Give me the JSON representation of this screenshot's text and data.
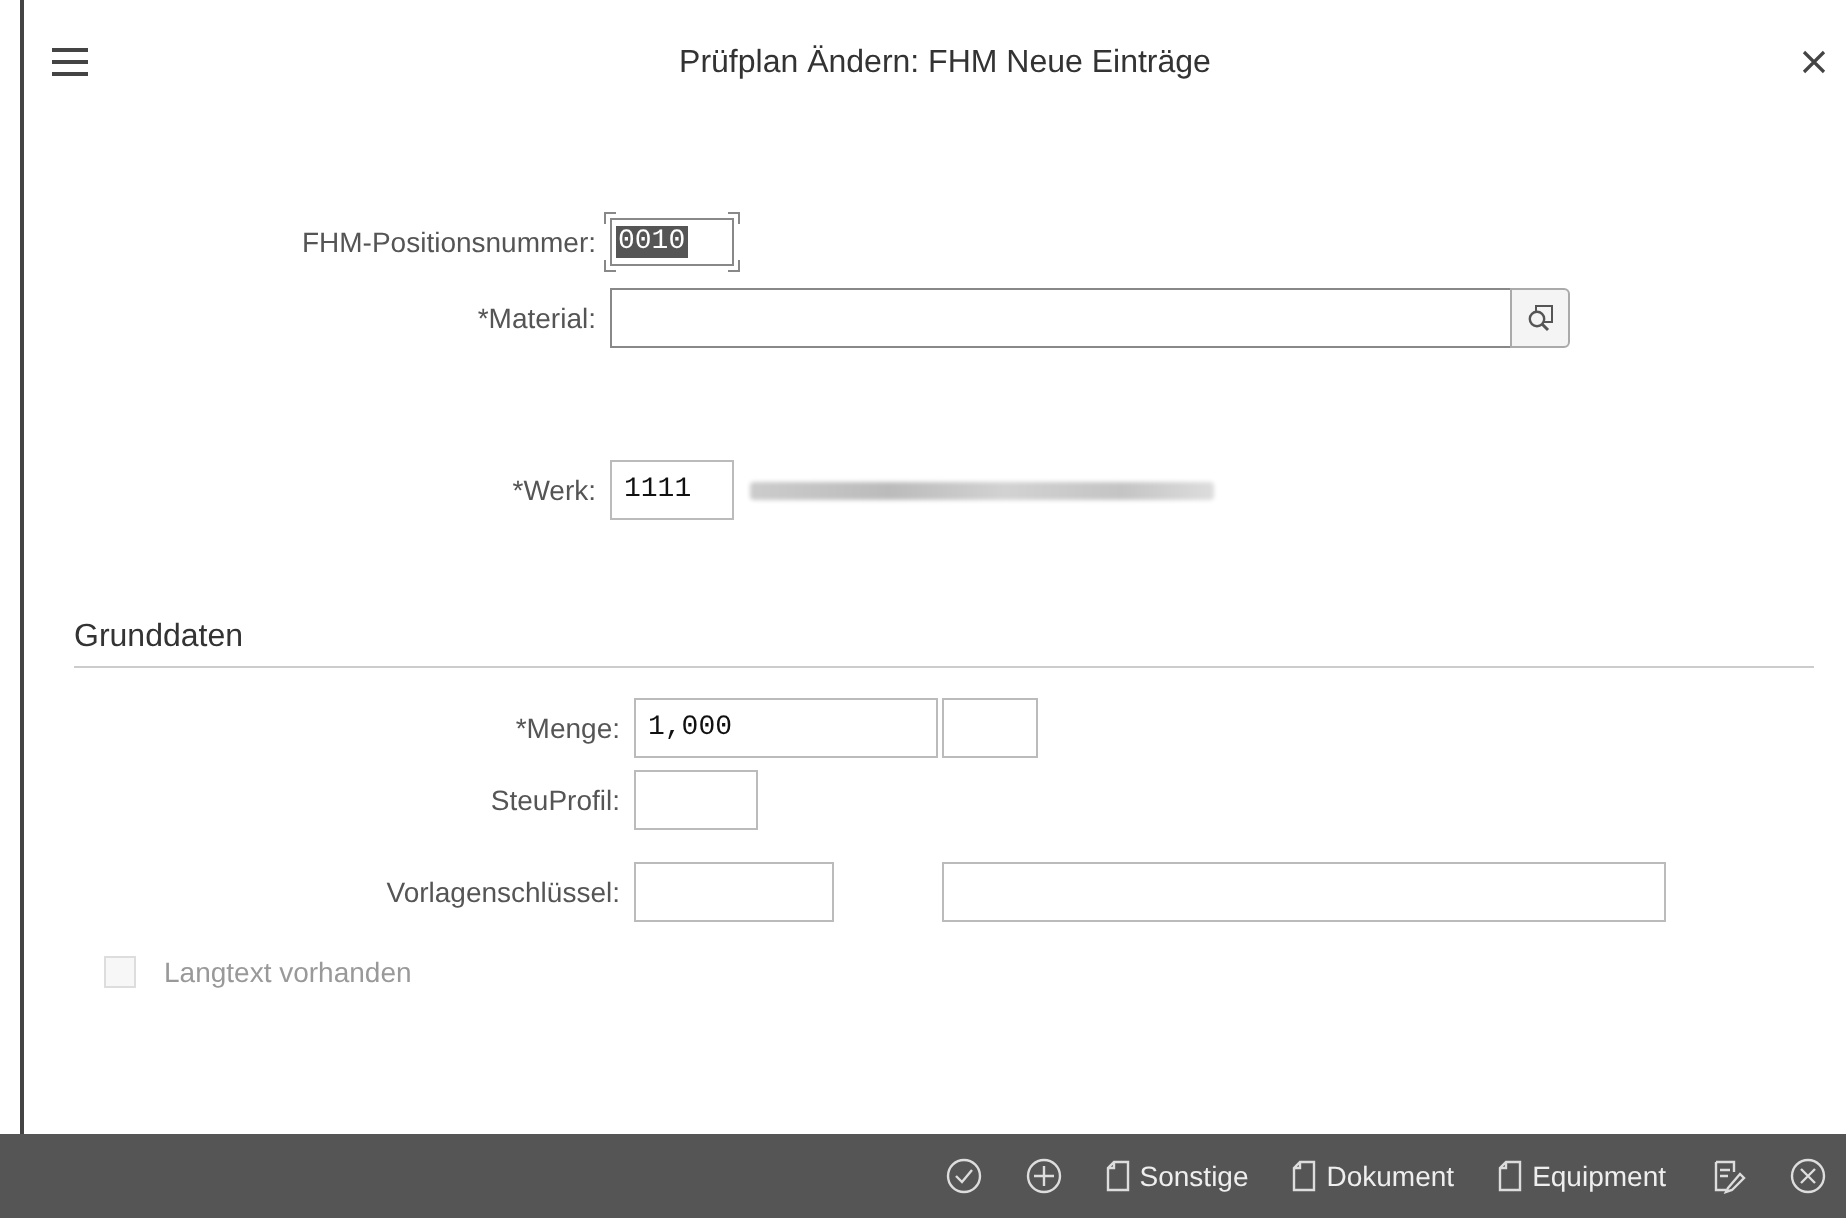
{
  "header": {
    "title": "Prüfplan Ändern: FHM Neue Einträge"
  },
  "top_fields": [
    {
      "label": "FHM-Positionsnummer:",
      "value": "0010",
      "focused": true
    },
    {
      "label": "*Material:",
      "focused": false,
      "value_help": true
    },
    {
      "label": "*Werk:",
      "value": "1111",
      "focused": false,
      "description_hidden": true
    }
  ],
  "section": {
    "title": "Grunddaten",
    "fields": [
      {
        "label": "*Menge:",
        "inputs": [
          {
            "kind": "text",
            "value": "1,000"
          },
          {
            "kind": "text"
          }
        ]
      },
      {
        "label": "SteuProfil:",
        "inputs": [
          {
            "kind": "text"
          }
        ]
      },
      {
        "label": "Vorlagenschlüssel:",
        "inputs": [
          {
            "kind": "text"
          },
          {
            "kind": "text"
          }
        ]
      }
    ],
    "checkbox": {
      "label": "Langtext vorhanden",
      "checked": false,
      "disabled": true
    }
  },
  "footer": {
    "buttons": [
      {
        "label": "Sonstige"
      },
      {
        "label": "Dokument"
      },
      {
        "label": "Equipment"
      }
    ]
  }
}
